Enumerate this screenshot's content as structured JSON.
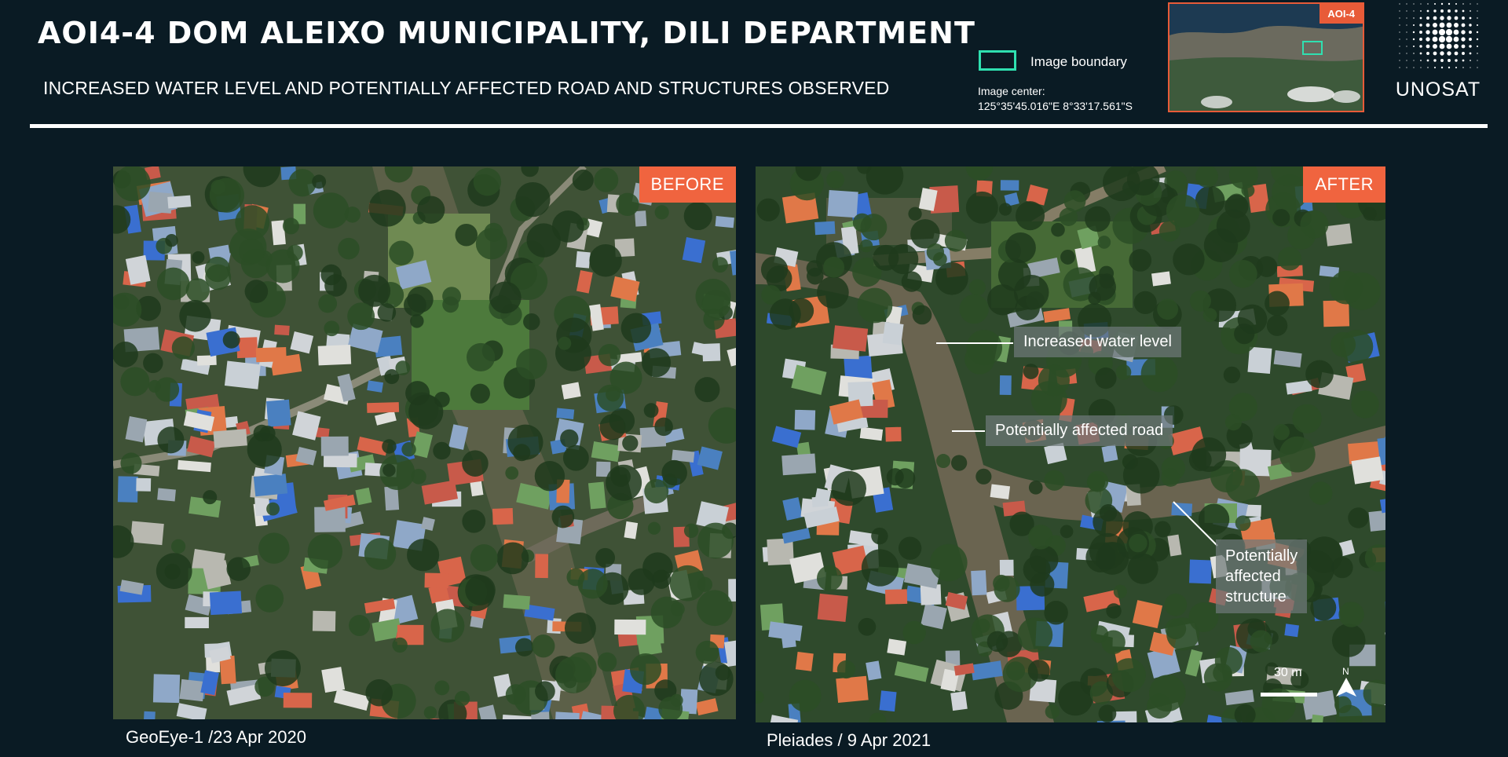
{
  "header": {
    "title": "AOI4-4 DOM ALEIXO MUNICIPALITY, DILI DEPARTMENT",
    "subtitle": "INCREASED WATER LEVEL AND POTENTIALLY AFFECTED ROAD AND STRUCTURES OBSERVED"
  },
  "legend": {
    "boundary_label": "Image boundary",
    "boundary_color": "#2fe0b0",
    "center_label": "Image center:",
    "center_coords": "125°35'45.016\"E   8°33'17.561\"S"
  },
  "inset": {
    "tag": "AOI-4",
    "tag_color": "#e85b38"
  },
  "logo": {
    "text": "UNOSAT"
  },
  "before": {
    "badge": "BEFORE",
    "caption": "GeoEye-1 /23 Apr 2020"
  },
  "after": {
    "badge": "AFTER",
    "caption": "Pleiades / 9 Apr 2021",
    "callouts": {
      "water": "Increased water level",
      "road": "Potentially affected road",
      "structure_1": "Potentially",
      "structure_2": "affected",
      "structure_3": "structure"
    },
    "scale_label": "30 m",
    "north_label": "N"
  },
  "colors": {
    "accent": "#f0643f",
    "background": "#0a1b24"
  }
}
